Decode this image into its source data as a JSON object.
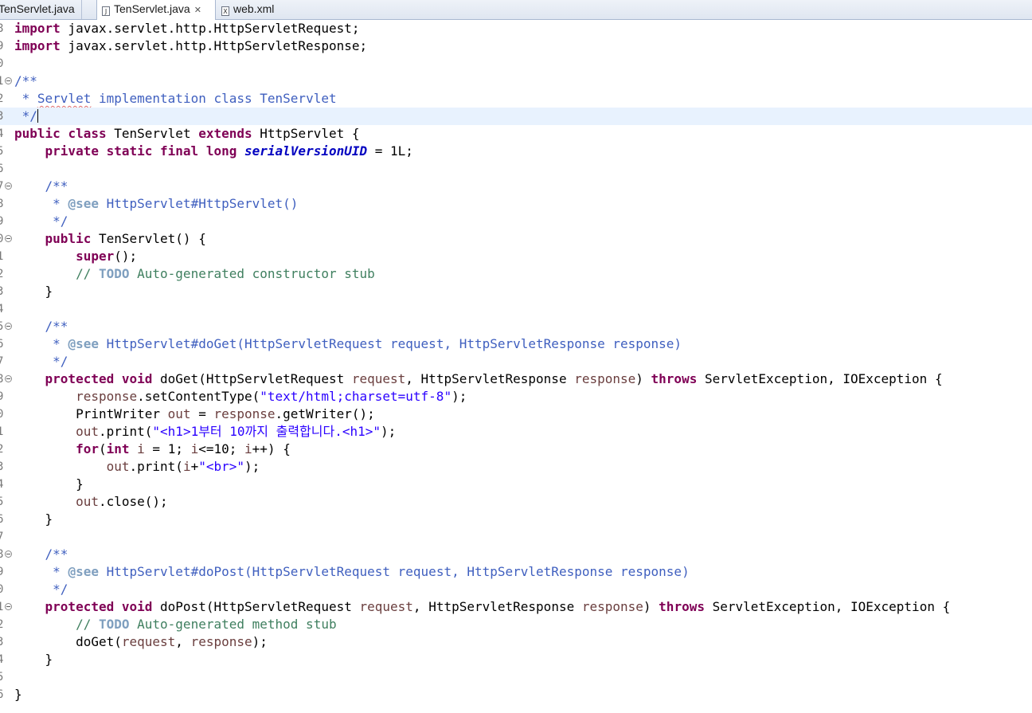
{
  "tabs": [
    {
      "label": "TenServlet.java",
      "state": "partial"
    },
    {
      "label": "TenServlet.java",
      "state": "active",
      "close": "✕"
    },
    {
      "label": "web.xml",
      "state": "inactive"
    }
  ],
  "editor": {
    "lines": [
      {
        "n": "8",
        "fold": false
      },
      {
        "n": "9",
        "fold": false
      },
      {
        "n": "0",
        "fold": false
      },
      {
        "n": "1",
        "fold": true
      },
      {
        "n": "2",
        "fold": false
      },
      {
        "n": "3",
        "fold": false
      },
      {
        "n": "4",
        "fold": false
      },
      {
        "n": "5",
        "fold": false
      },
      {
        "n": "6",
        "fold": false
      },
      {
        "n": "7",
        "fold": true
      },
      {
        "n": "8",
        "fold": false
      },
      {
        "n": "9",
        "fold": false
      },
      {
        "n": "0",
        "fold": true
      },
      {
        "n": "1",
        "fold": false
      },
      {
        "n": "2",
        "fold": false
      },
      {
        "n": "3",
        "fold": false
      },
      {
        "n": "4",
        "fold": false
      },
      {
        "n": "5",
        "fold": true
      },
      {
        "n": "6",
        "fold": false
      },
      {
        "n": "7",
        "fold": false
      },
      {
        "n": "8",
        "fold": true
      },
      {
        "n": "9",
        "fold": false
      },
      {
        "n": "0",
        "fold": false
      },
      {
        "n": "1",
        "fold": false
      },
      {
        "n": "2",
        "fold": false
      },
      {
        "n": "3",
        "fold": false
      },
      {
        "n": "4",
        "fold": false
      },
      {
        "n": "5",
        "fold": false
      },
      {
        "n": "6",
        "fold": false
      },
      {
        "n": "7",
        "fold": false
      },
      {
        "n": "8",
        "fold": true
      },
      {
        "n": "9",
        "fold": false
      },
      {
        "n": "0",
        "fold": false
      },
      {
        "n": "1",
        "fold": true
      },
      {
        "n": "2",
        "fold": false
      },
      {
        "n": "3",
        "fold": false
      },
      {
        "n": "4",
        "fold": false
      },
      {
        "n": "5",
        "fold": false
      },
      {
        "n": "6",
        "fold": false
      }
    ],
    "code": {
      "l0_kw": "import",
      "l0_rest": " javax.servlet.http.HttpServletRequest;",
      "l1_kw": "import",
      "l1_rest": " javax.servlet.http.HttpServletResponse;",
      "l3": "/**",
      "l4_pre": " * ",
      "l4_spell": "Servlet",
      "l4_rest": " implementation class TenServlet",
      "l5": " */",
      "l6_kw1": "public",
      "l6_kw2": "class",
      "l6_name": " TenServlet ",
      "l6_kw3": "extends",
      "l6_rest": " HttpServlet {",
      "l7_kw": "private static final long",
      "l7_fld": "serialVersionUID",
      "l7_rest": " = 1L;",
      "l9": "/**",
      "l10_pre": " * ",
      "l10_tag": "@see",
      "l10_rest": " HttpServlet#HttpServlet()",
      "l11": " */",
      "l12_kw": "public",
      "l12_rest": " TenServlet() {",
      "l13_kw": "super",
      "l13_rest": "();",
      "l14_pre": "// ",
      "l14_todo": "TODO",
      "l14_rest": " Auto-generated constructor stub",
      "l15": "}",
      "l17": "/**",
      "l18_pre": " * ",
      "l18_tag": "@see",
      "l18_rest": " HttpServlet#doGet(HttpServletRequest request, HttpServletResponse response)",
      "l19": " */",
      "l20_kw": "protected void",
      "l20_a": " doGet(HttpServletRequest ",
      "l20_v1": "request",
      "l20_b": ", HttpServletResponse ",
      "l20_v2": "response",
      "l20_c": ") ",
      "l20_kw2": "throws",
      "l20_d": " ServletException, IOException {",
      "l21_v": "response",
      "l21_a": ".setContentType(",
      "l21_str": "\"text/html;charset=utf-8\"",
      "l21_b": ");",
      "l22_a": "PrintWriter ",
      "l22_v1": "out",
      "l22_b": " = ",
      "l22_v2": "response",
      "l22_c": ".getWriter();",
      "l23_v": "out",
      "l23_a": ".print(",
      "l23_str": "\"<h1>1부터 10까지 출력합니다.<h1>\"",
      "l23_b": ");",
      "l24_kw1": "for",
      "l24_a": "(",
      "l24_kw2": "int",
      "l24_b": " ",
      "l24_v1": "i",
      "l24_c": " = 1; ",
      "l24_v2": "i",
      "l24_d": "<=10; ",
      "l24_v3": "i",
      "l24_e": "++) {",
      "l25_v1": "out",
      "l25_a": ".print(",
      "l25_v2": "i",
      "l25_b": "+",
      "l25_str": "\"<br>\"",
      "l25_c": ");",
      "l26": "}",
      "l27_v": "out",
      "l27_a": ".close();",
      "l28": "}",
      "l30": "/**",
      "l31_pre": " * ",
      "l31_tag": "@see",
      "l31_rest": " HttpServlet#doPost(HttpServletRequest request, HttpServletResponse response)",
      "l32": " */",
      "l33_kw": "protected void",
      "l33_a": " doPost(HttpServletRequest ",
      "l33_v1": "request",
      "l33_b": ", HttpServletResponse ",
      "l33_v2": "response",
      "l33_c": ") ",
      "l33_kw2": "throws",
      "l33_d": " ServletException, IOException {",
      "l34_pre": "// ",
      "l34_todo": "TODO",
      "l34_rest": " Auto-generated method stub",
      "l35_a": "doGet(",
      "l35_v1": "request",
      "l35_b": ", ",
      "l35_v2": "response",
      "l35_c": ");",
      "l36": "}",
      "l38": "}"
    }
  },
  "colors": {
    "keyword": "#7f0055",
    "comment": "#3f7f5f",
    "javadoc": "#3f5fbf",
    "string": "#2a00ff",
    "field": "#0000c0",
    "local_variable": "#6a3e3e",
    "current_line": "#e8f2fe"
  },
  "icons": {
    "java_file": "java-file-icon",
    "xml_file": "xml-file-icon",
    "close": "close-icon",
    "fold": "fold-minus-icon"
  }
}
